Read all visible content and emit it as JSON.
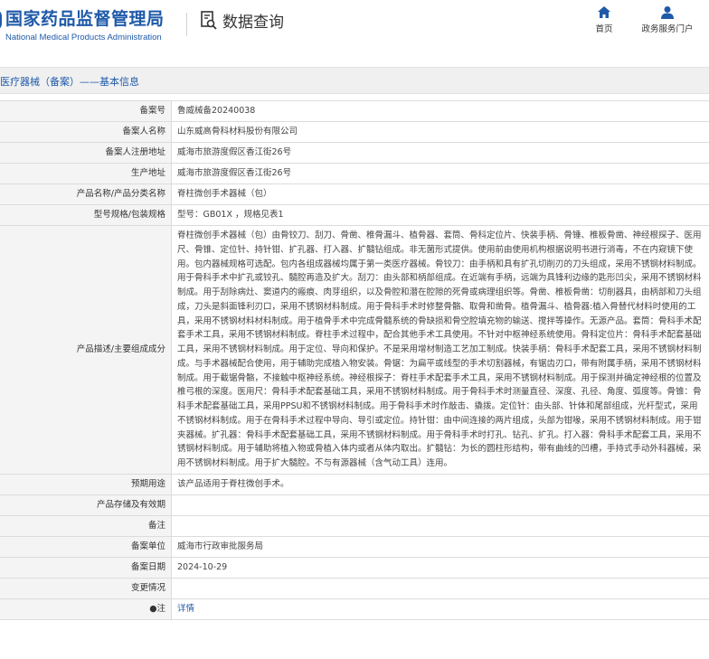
{
  "header": {
    "logo_cn": "国家药品监督管理局",
    "logo_en": "National Medical Products Administration",
    "section_title": "数据查询",
    "nav": [
      {
        "label": "首页",
        "icon": "home-icon"
      },
      {
        "label": "政务服务门户",
        "icon": "user-icon"
      }
    ]
  },
  "banner": {
    "text": "医疗器械（备案）——基本信息"
  },
  "colors": {
    "brand": "#1f5aa8",
    "label_bg": "#f4f4f4",
    "border": "#dcdcdc"
  },
  "rows": [
    {
      "label": "备案号",
      "value": "鲁威械备20240038"
    },
    {
      "label": "备案人名称",
      "value": "山东威高骨科材料股份有限公司"
    },
    {
      "label": "备案人注册地址",
      "value": "威海市旅游度假区香江街26号"
    },
    {
      "label": "生产地址",
      "value": "威海市旅游度假区香江街26号"
    },
    {
      "label": "产品名称/产品分类名称",
      "value": "脊柱微创手术器械（包）"
    },
    {
      "label": "型号规格/包装规格",
      "value": "型号：GB01X ，规格见表1"
    },
    {
      "label": "产品描述/主要组成成分",
      "value": "脊柱微创手术器械（包）由骨铰刀、刮刀、骨凿、椎骨漏斗、植骨器、套筒、骨科定位片、快装手柄、骨锤、椎板骨凿、神经根探子、医用尺、骨锥、定位针、持针钳、扩孔器、打入器、扩髓钻组成。非无菌形式提供。使用前由使用机构根据说明书进行消毒，不在内窥镜下使用。包内器械规格可选配。包内各组成器械均属于第一类医疗器械。骨铰刀：由手柄和具有扩孔切削刃的刀头组成，采用不锈钢材料制成。用于骨科手术中扩孔或铰孔、髓腔再造及扩大。刮刀：由头部和柄部组成。在近端有手柄，远端为具锋利边缘的匙形凹尖，采用不锈钢材料制成。用于刮除病灶、窦道内的瘢痕、肉芽组织，以及骨腔和潜在腔隙的死骨或病理组织等。骨凿、椎板骨凿：切削器具，由柄部和刀头组成，刀头是斜面锋利刃口，采用不锈钢材料制成。用于骨科手术时修整骨骼、取骨和凿骨。植骨漏斗、植骨器:植入骨替代材料时使用的工具，采用不锈钢材料材料制成。用于植骨手术中完成骨髓系统的骨缺损和骨空腔填充物的输送、搅拌等操作。无源产品。套筒：骨科手术配套手术工具，采用不锈钢材料制成。脊柱手术过程中，配合其他手术工具使用。不针对中枢神经系统使用。骨科定位片：骨科手术配套基础工具，采用不锈钢材料制成。用于定位、导向和保护。不是采用增材制造工艺加工制成。快装手柄：骨科手术配套工具，采用不锈钢材料制成。与手术器械配合使用，用于辅助完成植入物安装。骨锯：为扁平或线型的手术切割器械，有锯齿刃口，带有附属手柄，采用不锈钢材料制成。用于截锯骨骼，不接触中枢神经系统。神经根探子：脊柱手术配套手术工具，采用不锈钢材料制成。用于探测并确定神经根的位置及椎弓根的深度。医用尺：骨科手术配套基础工具，采用不锈钢材料制成。用于骨科手术时测量直径、深度、孔径、角度、弧度等。骨锥：骨科手术配套基础工具，采用PPSU和不锈钢材料制成。用于骨科手术时作敲击、撬拨。定位针：由头部、针体和尾部组成，光杆型式，采用不锈钢材料制成。用于在骨科手术过程中导向、导引或定位。持针钳：由中间连接的两片组成，头部为钳喙，采用不锈钢材料制成。用于钳夹器械。扩孔器：骨科手术配套基础工具，采用不锈钢材料制成。用于骨科手术时打孔、钻孔、扩孔。打入器：骨科手术配套工具，采用不锈钢材料制成。用于辅助将植入物或骨植入体内或者从体内取出。扩髓钻：为长的圆柱形结构，带有曲线的凹槽，手持式手动外科器械，采用不锈钢材料制成。用于扩大髓腔。不与有源器械（含气动工具）连用。"
    },
    {
      "label": "预期用途",
      "value": "该产品适用于脊柱微创手术。"
    },
    {
      "label": "产品存储及有效期",
      "value": ""
    },
    {
      "label": "备注",
      "value": ""
    },
    {
      "label": "备案单位",
      "value": "威海市行政审批服务局"
    },
    {
      "label": "备案日期",
      "value": "2024-10-29"
    },
    {
      "label": "变更情况",
      "value": ""
    },
    {
      "label": "●注",
      "value": "详情"
    }
  ]
}
